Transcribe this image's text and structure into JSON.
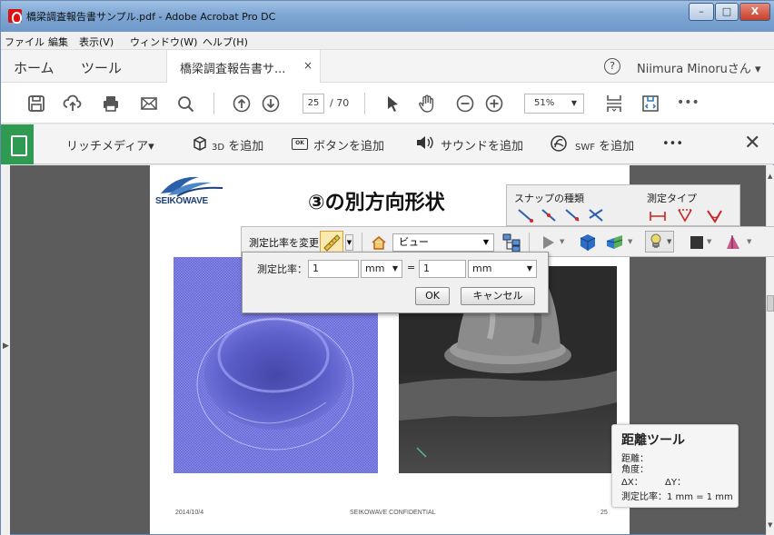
{
  "window": {
    "title": "橋梁調査報告書サンプル.pdf - Adobe Acrobat Pro DC",
    "min": "–",
    "max": "□",
    "close": "X"
  },
  "menu": [
    "ファイル",
    "編集",
    "表示(V)",
    "ウィンドウ(W)",
    "ヘルプ(H)"
  ],
  "tabs": {
    "home": "ホーム",
    "tools": "ツール",
    "doc": "橋梁調査報告書サ...",
    "doc_close": "×"
  },
  "user": {
    "help": "?",
    "name": "Niimura Minoruさん",
    "chevron": "▾"
  },
  "toolbar": {
    "page_current": "25",
    "page_total": "/ 70",
    "zoom": "51%",
    "more": "•••",
    "icons": [
      "save-icon",
      "upload-icon",
      "print-icon",
      "mail-icon",
      "search-icon",
      "page-up-icon",
      "page-down-icon",
      "cursor-icon",
      "hand-icon",
      "zoom-out-icon",
      "zoom-in-icon",
      "page-fit-icon",
      "scroll-mode-icon"
    ]
  },
  "media_bar": {
    "rich_media": "リッチメディア",
    "caret": "▾",
    "add_3d_prefix": "3D",
    "add_3d": "を追加",
    "add_button_prefix": "OK",
    "add_button": "ボタンを追加",
    "add_sound": "サウンドを追加",
    "add_swf_prefix": "SWF",
    "add_swf": "を追加",
    "more": "•••",
    "close": "✕"
  },
  "slide": {
    "logo": "SEIKOWAVE",
    "title": "③の別方向形状",
    "footer_date": "2014/10/4",
    "footer_conf": "SEIKOWAVE CONFIDENTIAL",
    "footer_page": "25"
  },
  "snap_panel": {
    "snap_type": "スナップの種類",
    "measure_type": "測定タイプ"
  },
  "draw_bar": {
    "scale_label": "測定比率を変更",
    "view_select": "ビュー"
  },
  "scale_dialog": {
    "label": "測定比率：",
    "left_value": "1",
    "left_unit": "mm",
    "equals": "=",
    "right_value": "1",
    "right_unit": "mm",
    "ok": "OK",
    "cancel": "キャンセル"
  },
  "distance_tool": {
    "title": "距離ツール",
    "distance": "距離：",
    "angle": "角度：",
    "dx": "ΔX：",
    "dy": "ΔY：",
    "scale": "測定比率：1 mm = 1 mm"
  },
  "colors": {
    "accent_green": "#2e9a52",
    "title_blue": "#7ea7d4",
    "mesh_blue": "#6d6fd6"
  }
}
